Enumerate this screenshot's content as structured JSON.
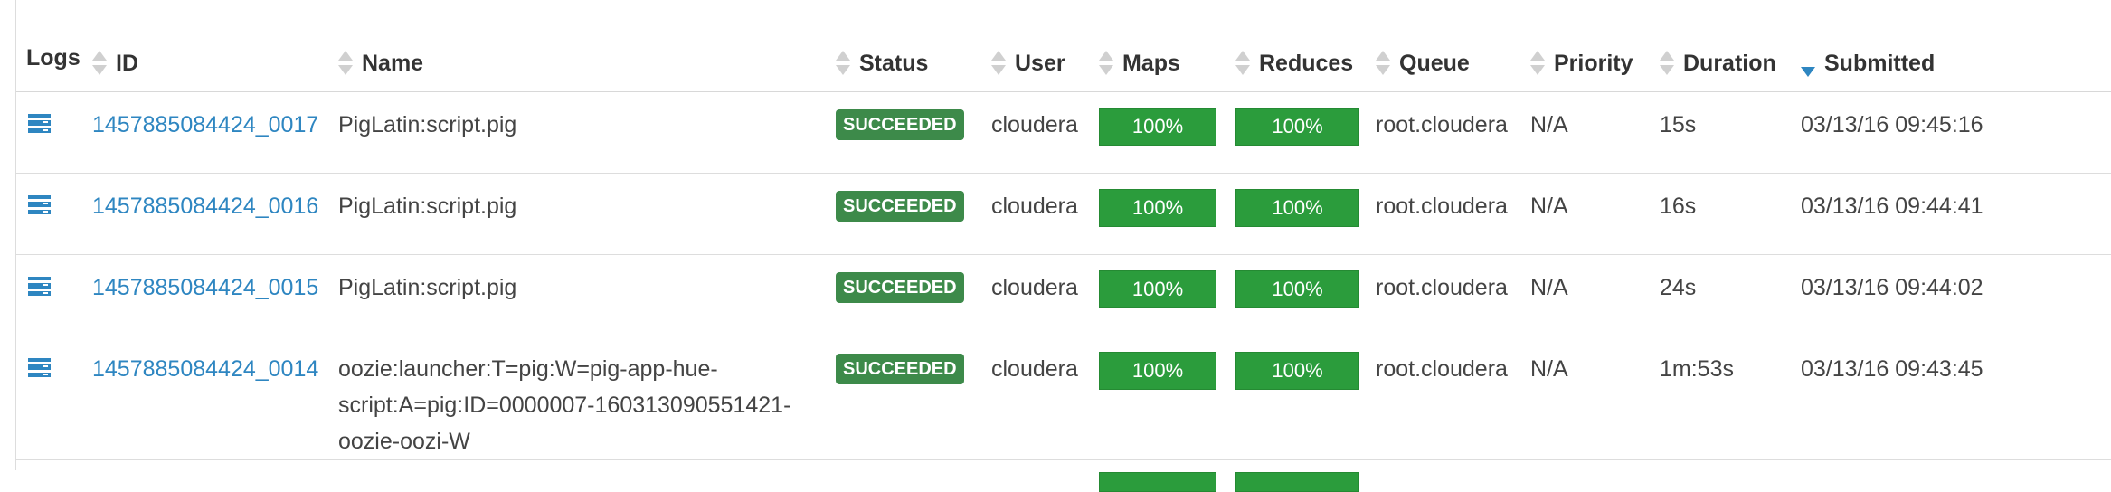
{
  "columns": {
    "logs": "Logs",
    "id": "ID",
    "name": "Name",
    "status": "Status",
    "user": "User",
    "maps": "Maps",
    "reduces": "Reduces",
    "queue": "Queue",
    "priority": "Priority",
    "duration": "Duration",
    "submitted": "Submitted"
  },
  "sort": {
    "column": "submitted",
    "direction": "descending"
  },
  "colors": {
    "link": "#2e86c1",
    "status_succeeded": "#3d8a4a",
    "progress": "#2b9c3c"
  },
  "jobs": [
    {
      "id": "1457885084424_0017",
      "name": "PigLatin:script.pig",
      "status": "SUCCEEDED",
      "user": "cloudera",
      "maps": "100%",
      "reduces": "100%",
      "queue": "root.cloudera",
      "priority": "N/A",
      "duration": "15s",
      "submitted": "03/13/16 09:45:16"
    },
    {
      "id": "1457885084424_0016",
      "name": "PigLatin:script.pig",
      "status": "SUCCEEDED",
      "user": "cloudera",
      "maps": "100%",
      "reduces": "100%",
      "queue": "root.cloudera",
      "priority": "N/A",
      "duration": "16s",
      "submitted": "03/13/16 09:44:41"
    },
    {
      "id": "1457885084424_0015",
      "name": "PigLatin:script.pig",
      "status": "SUCCEEDED",
      "user": "cloudera",
      "maps": "100%",
      "reduces": "100%",
      "queue": "root.cloudera",
      "priority": "N/A",
      "duration": "24s",
      "submitted": "03/13/16 09:44:02"
    },
    {
      "id": "1457885084424_0014",
      "name": "oozie:launcher:T=pig:W=pig-app-hue-script:A=pig:ID=0000007-160313090551421-oozie-oozi-W",
      "status": "SUCCEEDED",
      "user": "cloudera",
      "maps": "100%",
      "reduces": "100%",
      "queue": "root.cloudera",
      "priority": "N/A",
      "duration": "1m:53s",
      "submitted": "03/13/16 09:43:45"
    }
  ]
}
